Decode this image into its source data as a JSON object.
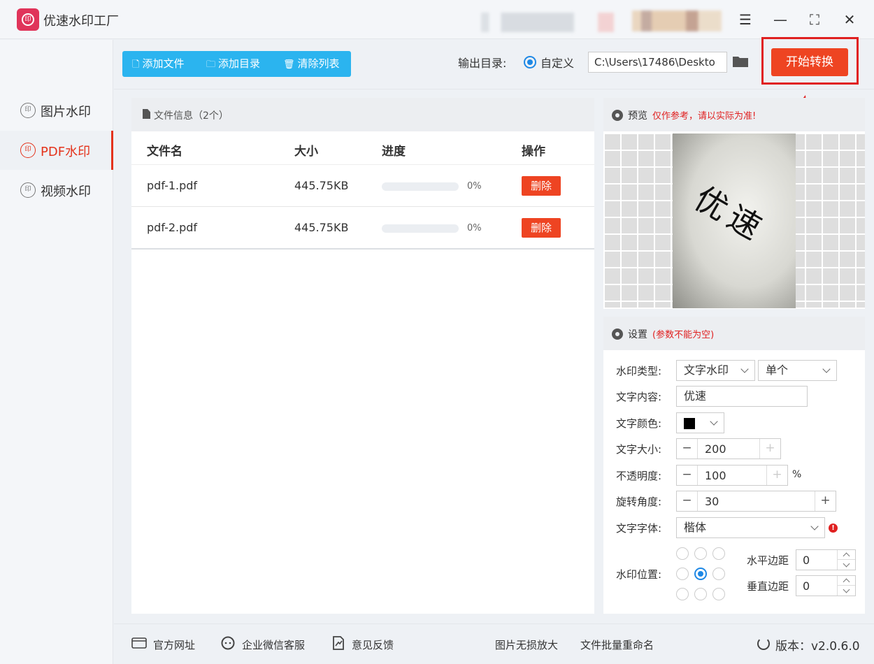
{
  "app": {
    "title": "优速水印工厂",
    "logo_glyph": "印"
  },
  "window_controls": {
    "menu": "☰",
    "minimize": "—",
    "maximize": "⛶",
    "close": "✕"
  },
  "sidebar": {
    "items": [
      {
        "label": "图片水印",
        "icon": "印",
        "active": false
      },
      {
        "label": "PDF水印",
        "icon": "印",
        "active": true
      },
      {
        "label": "视频水印",
        "icon": "印",
        "active": false
      }
    ]
  },
  "toolbar": {
    "add_file": "添加文件",
    "add_dir": "添加目录",
    "clear_list": "清除列表",
    "output_label": "输出目录:",
    "custom_option": "自定义",
    "output_path": "C:\\Users\\17486\\Deskto",
    "start_button": "开始转换"
  },
  "files": {
    "header": "文件信息（2个）",
    "columns": {
      "name": "文件名",
      "size": "大小",
      "progress": "进度",
      "action": "操作"
    },
    "rows": [
      {
        "name": "pdf-1.pdf",
        "size": "445.75KB",
        "progress_pct": 0,
        "progress_text": "0%",
        "action": "删除"
      },
      {
        "name": "pdf-2.pdf",
        "size": "445.75KB",
        "progress_pct": 0,
        "progress_text": "0%",
        "action": "删除"
      }
    ]
  },
  "preview": {
    "title": "预览",
    "note": "仅作参考，请以实际为准!",
    "watermark_text": "优速"
  },
  "settings": {
    "title": "设置",
    "note": "(参数不能为空)",
    "labels": {
      "type": "水印类型:",
      "content": "文字内容:",
      "color": "文字颜色:",
      "size": "文字大小:",
      "opacity": "不透明度:",
      "rotation": "旋转角度:",
      "font": "文字字体:",
      "position": "水印位置:",
      "h_margin": "水平边距",
      "v_margin": "垂直边距"
    },
    "type_value": "文字水印",
    "mode_value": "单个",
    "content_value": "优速",
    "color_value": "#000000",
    "size_value": "200",
    "opacity_value": "100",
    "opacity_unit": "%",
    "rotation_value": "30",
    "font_value": "楷体",
    "position_selected": "center",
    "h_margin_value": "0",
    "v_margin_value": "0",
    "minus": "−",
    "plus": "+"
  },
  "footer": {
    "website": "官方网址",
    "wechat": "企业微信客服",
    "feedback": "意见反馈",
    "lossless": "图片无损放大",
    "rename": "文件批量重命名",
    "version": "版本：v2.0.6.0"
  },
  "colors": {
    "accent_red": "#ee4422",
    "accent_blue": "#2bb4ef",
    "radio_blue": "#1e88e5"
  }
}
